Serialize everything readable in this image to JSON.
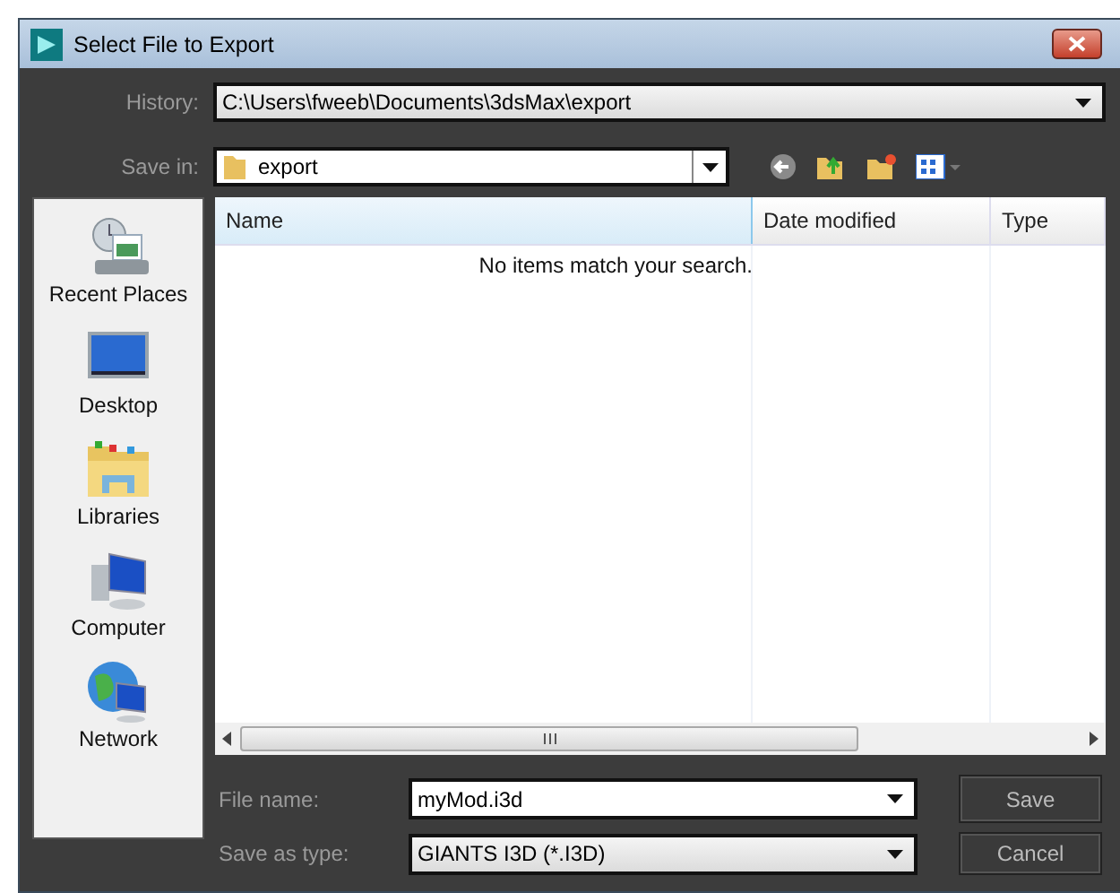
{
  "window": {
    "title": "Select File to Export"
  },
  "history": {
    "label": "History:",
    "value": "C:\\Users\\fweeb\\Documents\\3dsMax\\export"
  },
  "save_in": {
    "label": "Save in:",
    "value": "export"
  },
  "sidebar": {
    "items": [
      {
        "label": "Recent Places",
        "kind": "recent"
      },
      {
        "label": "Desktop",
        "kind": "desktop"
      },
      {
        "label": "Libraries",
        "kind": "libraries"
      },
      {
        "label": "Computer",
        "kind": "computer"
      },
      {
        "label": "Network",
        "kind": "network"
      }
    ]
  },
  "file_list": {
    "columns": [
      "Name",
      "Date modified",
      "Type"
    ],
    "empty_message": "No items match your search."
  },
  "file_name": {
    "label": "File name:",
    "value": "myMod.i3d"
  },
  "save_as_type": {
    "label": "Save as type:",
    "value": "GIANTS I3D (*.I3D)"
  },
  "buttons": [
    "Save",
    "Cancel"
  ]
}
